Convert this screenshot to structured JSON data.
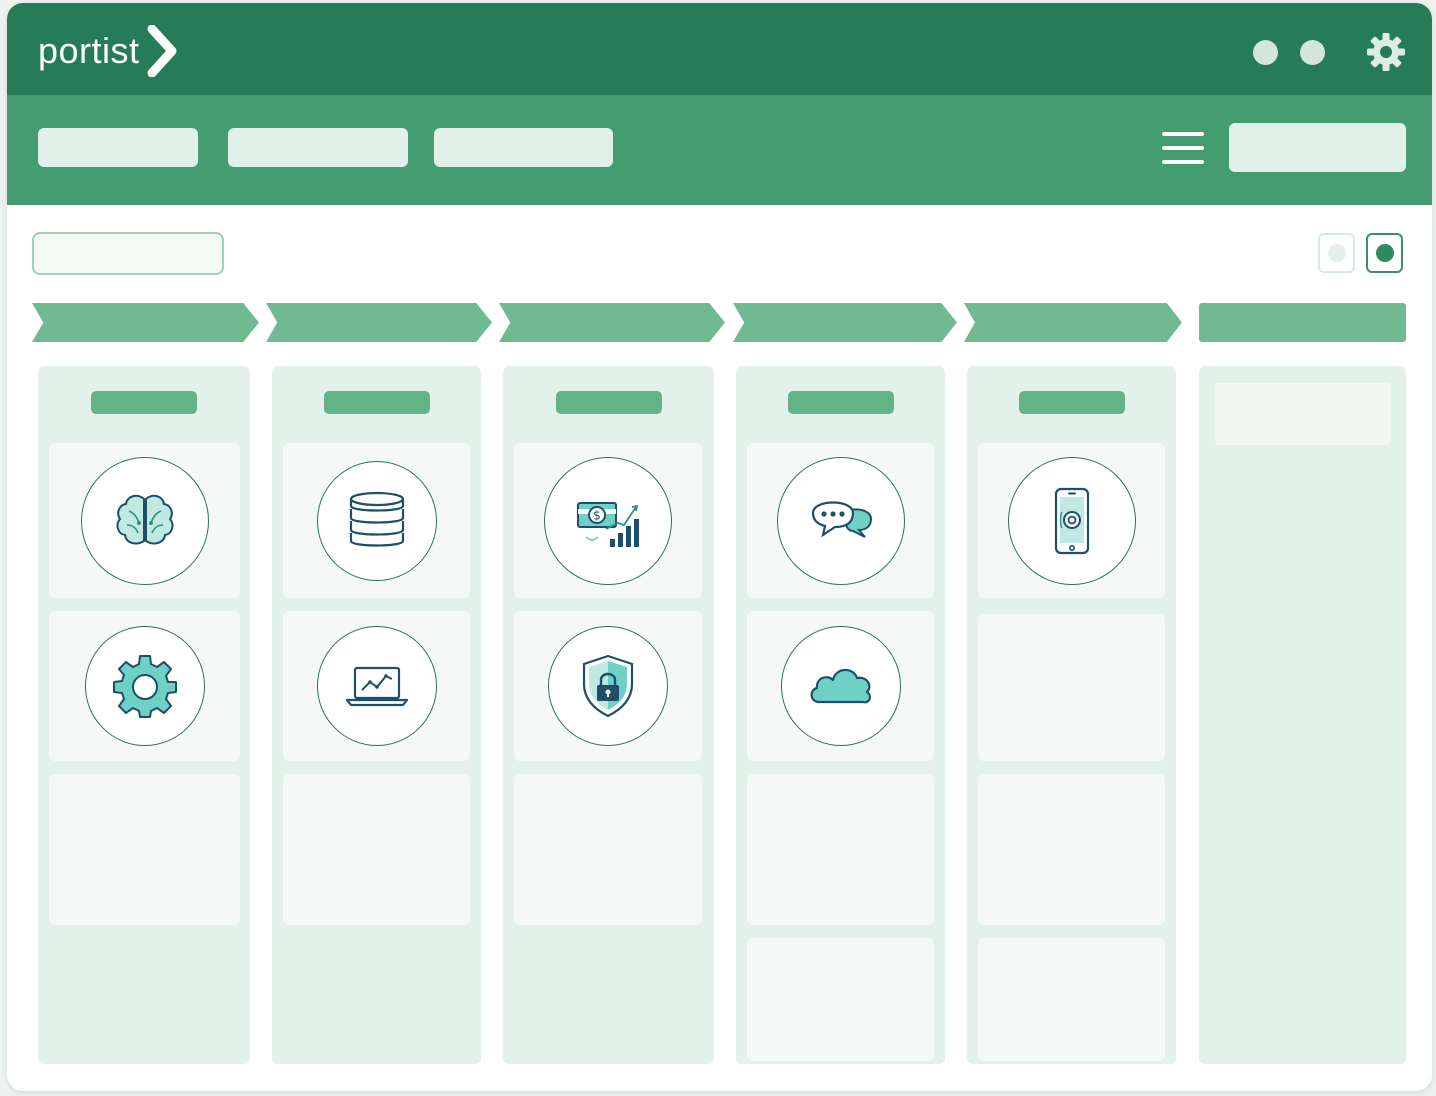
{
  "app": {
    "logo_text": "portist",
    "colors": {
      "header": "#267c56",
      "toolbar": "#449d70",
      "stage": "#6fba92",
      "column": "#e2f1e9",
      "card": "#f4f8f6",
      "icon_teal": "#6fd1c6",
      "icon_navy": "#1d4f6b"
    }
  },
  "header": {
    "dots": [
      "status-dot",
      "status-dot"
    ],
    "settings_icon": "gear-icon"
  },
  "toolbar": {
    "buttons": [
      {
        "label": ""
      },
      {
        "label": ""
      },
      {
        "label": ""
      }
    ],
    "menu_icon": "hamburger-icon",
    "search": {
      "value": "",
      "placeholder": ""
    }
  },
  "filter": {
    "value": "",
    "placeholder": ""
  },
  "view_toggles": [
    "grid-view",
    "list-view"
  ],
  "stages": [
    {
      "label": ""
    },
    {
      "label": ""
    },
    {
      "label": ""
    },
    {
      "label": ""
    },
    {
      "label": ""
    },
    {
      "label": ""
    }
  ],
  "columns": [
    {
      "title": "",
      "cards": [
        {
          "icon": "brain-icon"
        },
        {
          "icon": "gear-icon"
        },
        {
          "icon": ""
        }
      ]
    },
    {
      "title": "",
      "cards": [
        {
          "icon": "database-icon"
        },
        {
          "icon": "laptop-chart-icon"
        },
        {
          "icon": ""
        }
      ]
    },
    {
      "title": "",
      "cards": [
        {
          "icon": "money-growth-icon"
        },
        {
          "icon": "shield-lock-icon"
        },
        {
          "icon": ""
        }
      ]
    },
    {
      "title": "",
      "cards": [
        {
          "icon": "chat-bubbles-icon"
        },
        {
          "icon": "cloud-icon"
        },
        {
          "icon": ""
        },
        {
          "icon": ""
        }
      ]
    },
    {
      "title": "",
      "cards": [
        {
          "icon": "smartphone-icon"
        },
        {
          "icon": ""
        },
        {
          "icon": ""
        },
        {
          "icon": ""
        }
      ]
    },
    {
      "title": "",
      "cards": []
    }
  ]
}
